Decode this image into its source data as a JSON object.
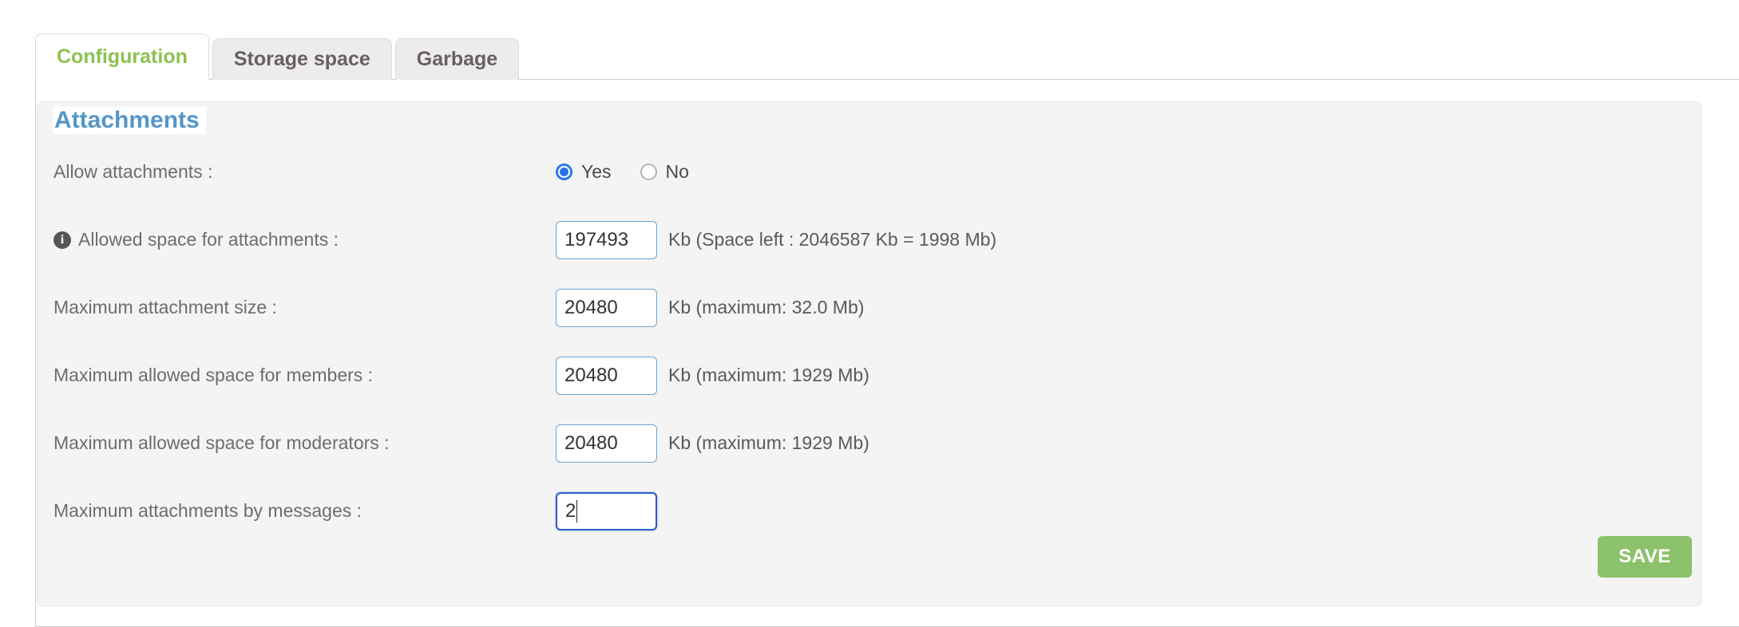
{
  "tabs": [
    {
      "label": "Configuration",
      "active": true
    },
    {
      "label": "Storage space",
      "active": false
    },
    {
      "label": "Garbage",
      "active": false
    }
  ],
  "fieldset": {
    "legend": "Attachments"
  },
  "rows": {
    "allow_attachments": {
      "label": "Allow attachments :",
      "yes_label": "Yes",
      "no_label": "No",
      "selected": "Yes"
    },
    "allowed_space": {
      "label": "Allowed space for attachments :",
      "icon": "info-icon",
      "value": "197493",
      "hint": "Kb (Space left : 2046587 Kb = 1998 Mb)"
    },
    "max_attachment_size": {
      "label": "Maximum attachment size :",
      "value": "20480",
      "hint": "Kb (maximum: 32.0 Mb)"
    },
    "max_space_members": {
      "label": "Maximum allowed space for members :",
      "value": "20480",
      "hint": "Kb (maximum: 1929 Mb)"
    },
    "max_space_moderators": {
      "label": "Maximum allowed space for moderators :",
      "value": "20480",
      "hint": "Kb (maximum: 1929 Mb)"
    },
    "max_attachments_by_message": {
      "label": "Maximum attachments by messages :",
      "value": "2",
      "hint": "",
      "focused": true
    }
  },
  "actions": {
    "save_label": "SAVE"
  },
  "colors": {
    "active_tab_text": "#8cc152",
    "legend_blue": "#5596c8",
    "input_border": "#6ba4cf",
    "input_border_focus": "#2a5cc8",
    "radio_accent": "#2a72e8",
    "save_green": "#8cc26a",
    "fieldset_bg": "#f4f4f4"
  }
}
